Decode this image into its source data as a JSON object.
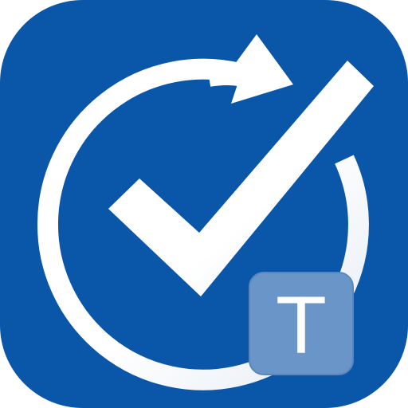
{
  "icon": {
    "badge_letter": "T",
    "colors": {
      "background": "#0A56A8",
      "foreground": "#FFFFFF",
      "badge_fill": "#6995C9",
      "badge_stroke": "#5B86BC"
    },
    "parts": [
      "refresh-arrow-icon",
      "checkmark-icon",
      "badge-t"
    ]
  }
}
